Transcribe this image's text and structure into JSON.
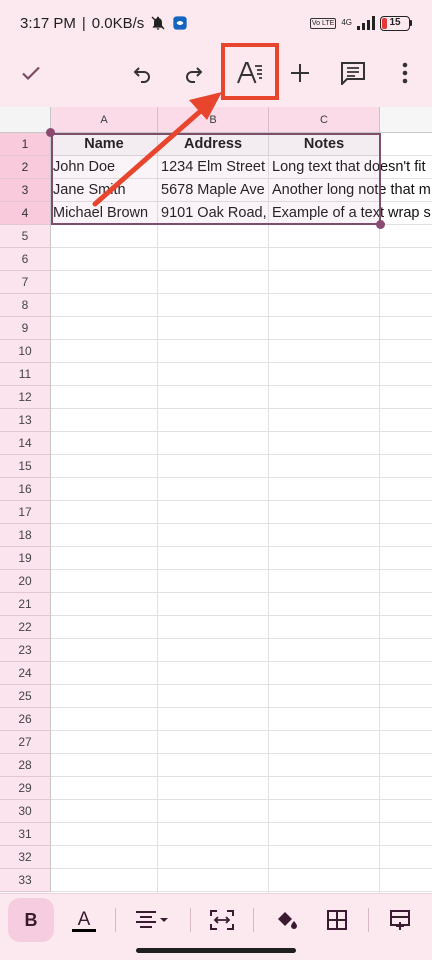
{
  "status_bar": {
    "time": "3:17 PM",
    "network_speed": "0.0KB/s",
    "separator": "|",
    "volte_label": "Vo LTE",
    "network_gen": "4G",
    "battery_level": "15",
    "icons": [
      "muted-bell-icon",
      "app-notification-icon",
      "volte-icon",
      "signal-icon",
      "battery-icon"
    ]
  },
  "toolbar": {
    "icons": [
      "check-icon",
      "undo-icon",
      "redo-icon",
      "text-format-icon",
      "add-icon",
      "comment-icon",
      "more-vert-icon"
    ]
  },
  "sheet": {
    "column_headers": [
      "A",
      "B",
      "C"
    ],
    "row_numbers": [
      "1",
      "2",
      "3",
      "4",
      "5",
      "6",
      "7",
      "8",
      "9",
      "10",
      "11",
      "12",
      "13",
      "14",
      "15",
      "16",
      "17",
      "18",
      "19",
      "20",
      "21",
      "22",
      "23",
      "24",
      "25",
      "26",
      "27",
      "28",
      "29",
      "30",
      "31",
      "32",
      "33"
    ],
    "rows": [
      [
        "Name",
        "Address",
        "Notes"
      ],
      [
        "John Doe",
        "1234 Elm Street",
        "Long text that doesn't fit"
      ],
      [
        "Jane Smith",
        "5678 Maple Ave",
        "Another long note that m"
      ],
      [
        "Michael Brown",
        "9101 Oak Road,",
        "Example of a text wrap s"
      ]
    ]
  },
  "bottom_bar": {
    "bold_label": "B",
    "text_color_label": "A",
    "text_color": "#000000",
    "icons": [
      "bold-icon",
      "text-color-icon",
      "align-icon",
      "merge-cells-icon",
      "fill-color-icon",
      "borders-icon",
      "insert-icon"
    ]
  },
  "colors": {
    "accent": "#e8452e",
    "selection": "#7e4e6d",
    "header_highlight": "#fcdbe8"
  }
}
